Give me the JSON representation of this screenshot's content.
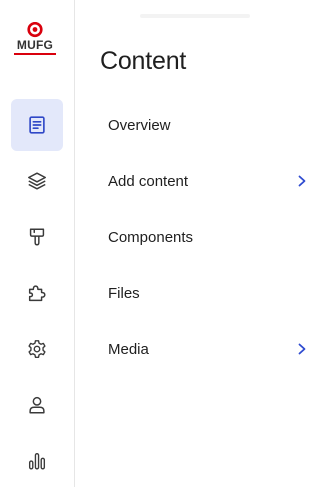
{
  "brand": {
    "name": "MUFG",
    "accent": "#d9000d"
  },
  "rail": {
    "items": [
      {
        "name": "content",
        "icon": "document-icon",
        "active": true
      },
      {
        "name": "structure",
        "icon": "layers-icon",
        "active": false
      },
      {
        "name": "appearance",
        "icon": "paint-brush-icon",
        "active": false
      },
      {
        "name": "extend",
        "icon": "puzzle-icon",
        "active": false
      },
      {
        "name": "configuration",
        "icon": "gear-icon",
        "active": false
      },
      {
        "name": "people",
        "icon": "person-icon",
        "active": false
      },
      {
        "name": "reports",
        "icon": "bar-chart-icon",
        "active": false
      }
    ],
    "active_bg": "#e3e8fa",
    "active_color": "#3048c7"
  },
  "panel": {
    "title": "Content",
    "items": [
      {
        "label": "Overview",
        "has_submenu": false
      },
      {
        "label": "Add content",
        "has_submenu": true
      },
      {
        "label": "Components",
        "has_submenu": false
      },
      {
        "label": "Files",
        "has_submenu": false
      },
      {
        "label": "Media",
        "has_submenu": true
      }
    ],
    "chevron_color": "#2f4bd0"
  }
}
